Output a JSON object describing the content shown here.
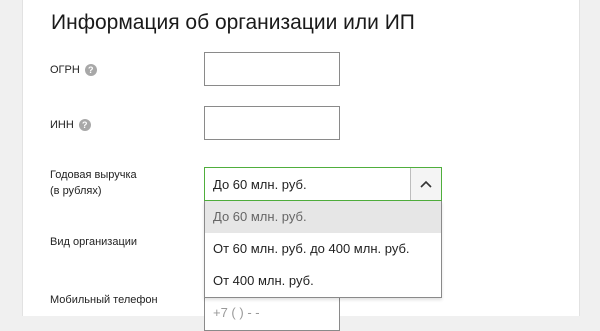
{
  "section": {
    "title": "Информация об организации или ИП"
  },
  "fields": {
    "ogrn": {
      "label": "ОГРН",
      "value": ""
    },
    "inn": {
      "label": "ИНН",
      "value": ""
    },
    "revenue": {
      "label_line1": "Годовая выручка",
      "label_line2": "(в рублях)",
      "selected": "До 60 млн. руб.",
      "options": [
        "До 60 млн. руб.",
        "От 60 млн. руб. до 400 млн. руб.",
        "От 400 млн. руб."
      ]
    },
    "org_type": {
      "label": "Вид организации"
    },
    "phone": {
      "label": "Мобильный телефон",
      "placeholder": "+7 (   )    -  -  "
    }
  },
  "icons": {
    "help": "question-mark",
    "dropdown": "chevron-up"
  },
  "colors": {
    "focus_border": "#4fae3c",
    "highlight_option": "#e6e6e6"
  }
}
